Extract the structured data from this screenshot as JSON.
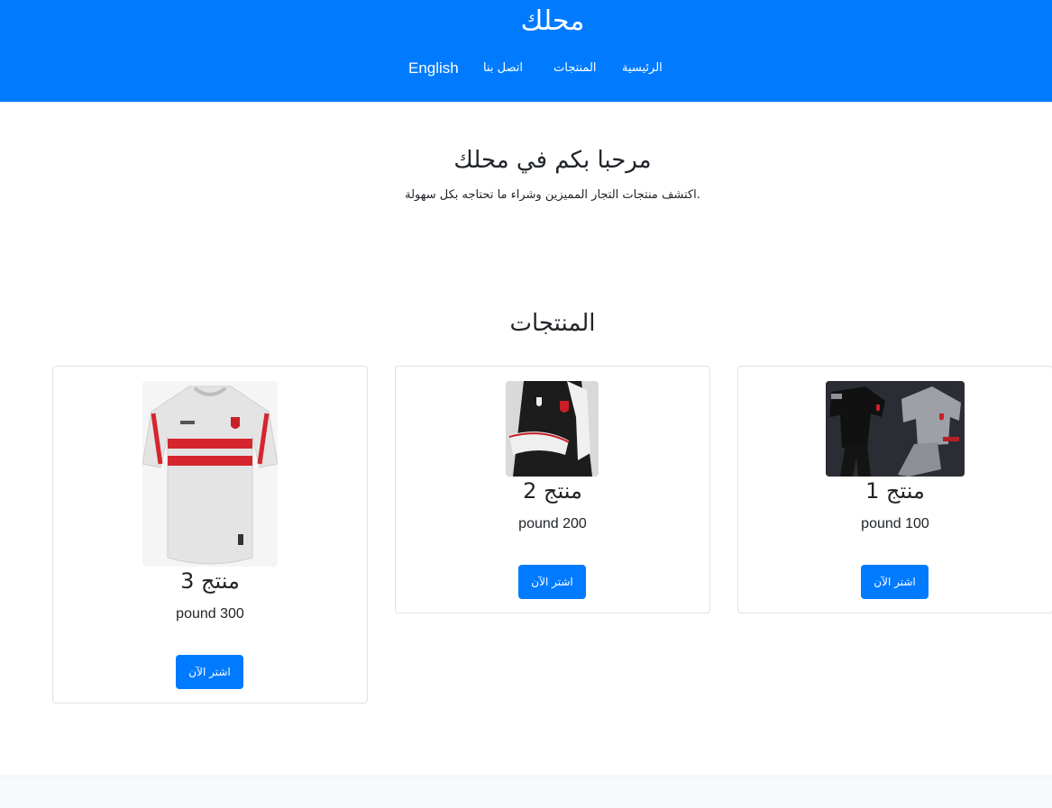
{
  "header": {
    "site_title": "محلك",
    "nav": {
      "home": "الرئيسية",
      "products": "المنتجات",
      "contact": "اتصل بنا",
      "language": "English"
    }
  },
  "hero": {
    "title": "مرحبا بكم في محلك",
    "subtitle": "اكتشف منتجات التجار المميزين وشراء ما تحتاجه بكل سهولة."
  },
  "products_section": {
    "title": "المنتجات",
    "items": [
      {
        "name": "منتج 1",
        "price": "pound 100",
        "button": "اشتر الآن",
        "image": "tracksuit-image"
      },
      {
        "name": "منتج 2",
        "price": "pound 200",
        "button": "اشتر الآن",
        "image": "jacket-image"
      },
      {
        "name": "منتج 3",
        "price": "pound 300",
        "button": "اشتر الآن",
        "image": "jersey-image"
      }
    ]
  },
  "colors": {
    "primary": "#007bff",
    "footer": "#f8f9fa"
  }
}
